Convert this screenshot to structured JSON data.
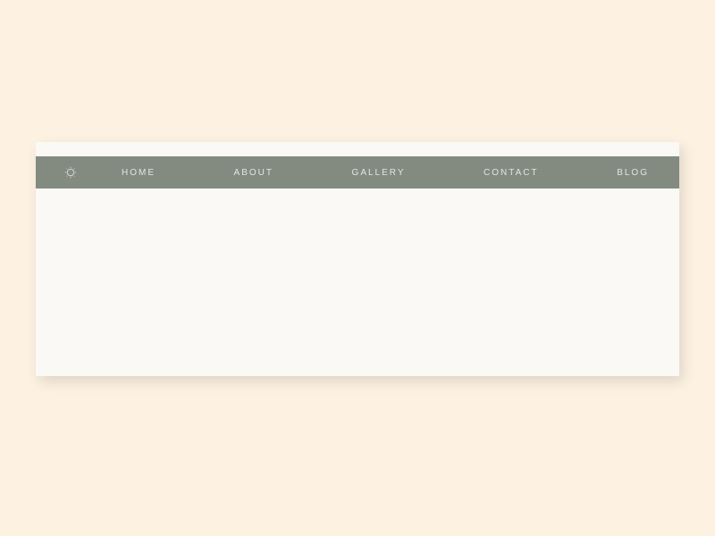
{
  "colors": {
    "page_bg": "#fdf1e1",
    "card_bg": "#faf9f6",
    "nav_bg": "#838b80",
    "nav_text": "#e3e5e0",
    "logo_stroke": "#d7d9d4"
  },
  "nav": {
    "items": [
      {
        "label": "HOME",
        "name": "nav-home"
      },
      {
        "label": "ABOUT",
        "name": "nav-about"
      },
      {
        "label": "GALLERY",
        "name": "nav-gallery"
      },
      {
        "label": "CONTACT",
        "name": "nav-contact"
      },
      {
        "label": "BLOG",
        "name": "nav-blog"
      }
    ]
  },
  "logo": {
    "name": "sun-outline-icon"
  }
}
